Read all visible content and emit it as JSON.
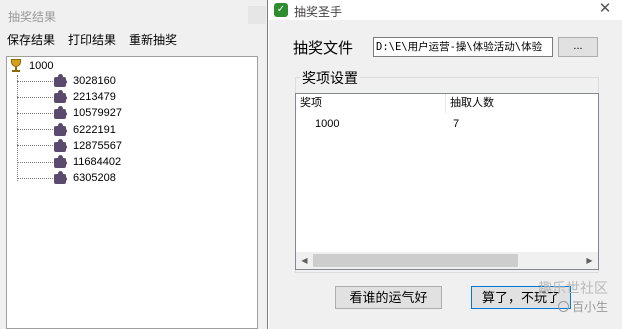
{
  "results_window": {
    "title": "抽奖结果",
    "menu": [
      "保存结果",
      "打印结果",
      "重新抽奖"
    ],
    "tree_root": "1000",
    "tree_items": [
      "3028160",
      "2213479",
      "10579927",
      "6222191",
      "12875567",
      "11684402",
      "6305208"
    ]
  },
  "main_window": {
    "title": "抽奖圣手",
    "close_glyph": "✕",
    "app_icon_glyph": "✓",
    "file_label": "抽奖文件",
    "file_path": "D:\\E\\用户运营-操\\体验活动\\体验",
    "browse_label": "...",
    "group_label": "奖项设置",
    "columns": [
      "奖项",
      "抽取人数"
    ],
    "rows": [
      {
        "prize": "1000",
        "count": "7"
      }
    ],
    "scroll_left": "◀",
    "scroll_right": "▶",
    "lucky_button": "看谁的运气好",
    "quit_button": "算了，不玩了"
  },
  "watermark": {
    "line1": "趣乐世社区",
    "line2": "百小生"
  },
  "colors": {
    "accent_border": "#0078d7",
    "app_icon": "#2f8d2f"
  }
}
